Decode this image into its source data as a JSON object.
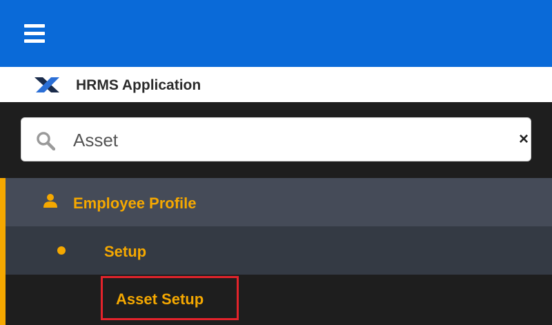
{
  "header": {
    "menu_icon": "hamburger-menu-icon",
    "brand_color": "#0a6ad8"
  },
  "brand": {
    "logo_icon": "x-logo-icon",
    "title": "HRMS Application"
  },
  "search": {
    "value": "Asset",
    "search_icon": "search-icon",
    "clear_icon": "close-icon",
    "clear_glyph": "×"
  },
  "menu": {
    "accent_color": "#f5a800",
    "items": [
      {
        "label": "Employee Profile",
        "icon": "user-icon",
        "level": 0
      },
      {
        "label": "Setup",
        "icon": "dot-icon",
        "level": 1
      },
      {
        "label": "Asset Setup",
        "level": 2,
        "highlighted": true,
        "highlight_color": "#e3232b"
      }
    ]
  }
}
